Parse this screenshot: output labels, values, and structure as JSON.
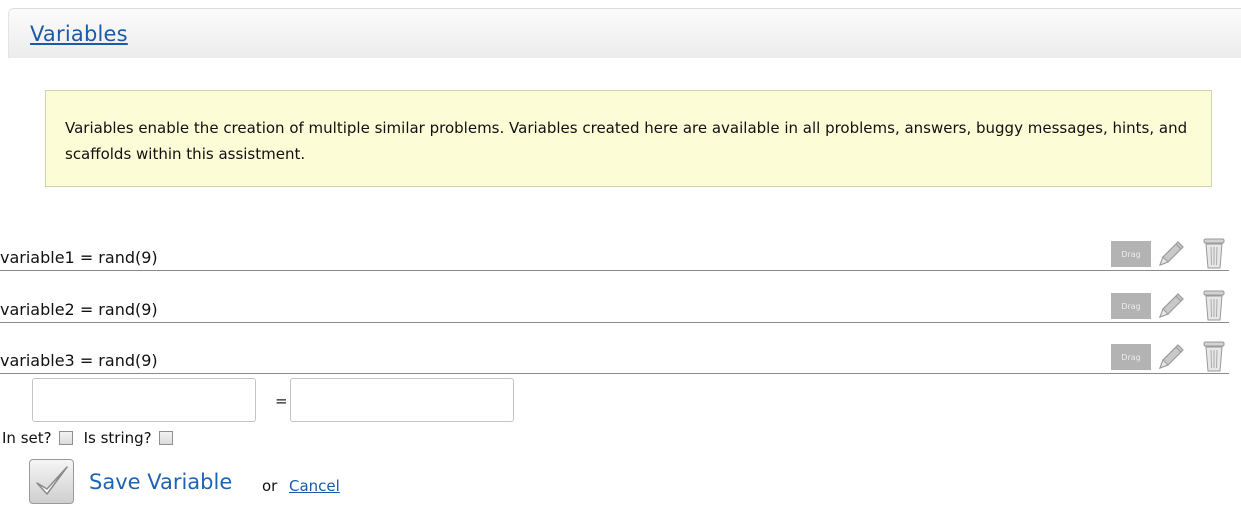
{
  "header": {
    "title": "Variables"
  },
  "info": {
    "text": "Variables enable the creation of multiple similar problems. Variables created here are available in all problems, answers, buggy messages, hints, and scaffolds within this assistment."
  },
  "variables": [
    {
      "definition": "variable1 = rand(9)",
      "drag_label": "Drag"
    },
    {
      "definition": "variable2 = rand(9)",
      "drag_label": "Drag"
    },
    {
      "definition": "variable3 = rand(9)",
      "drag_label": "Drag"
    }
  ],
  "form": {
    "name_value": "",
    "equals": "=",
    "value_value": "",
    "in_set_label": "In set?",
    "is_string_label": "Is string?",
    "save_label": "Save Variable",
    "or_label": "or",
    "cancel_label": "Cancel"
  },
  "icons": {
    "drag": "drag-handle-icon",
    "edit": "pencil-icon",
    "delete": "trash-icon",
    "save": "checkmark-icon"
  },
  "colors": {
    "link": "#1a5aa6",
    "info_bg": "#fcfcd6",
    "drag_bg": "#b3b3b3"
  }
}
